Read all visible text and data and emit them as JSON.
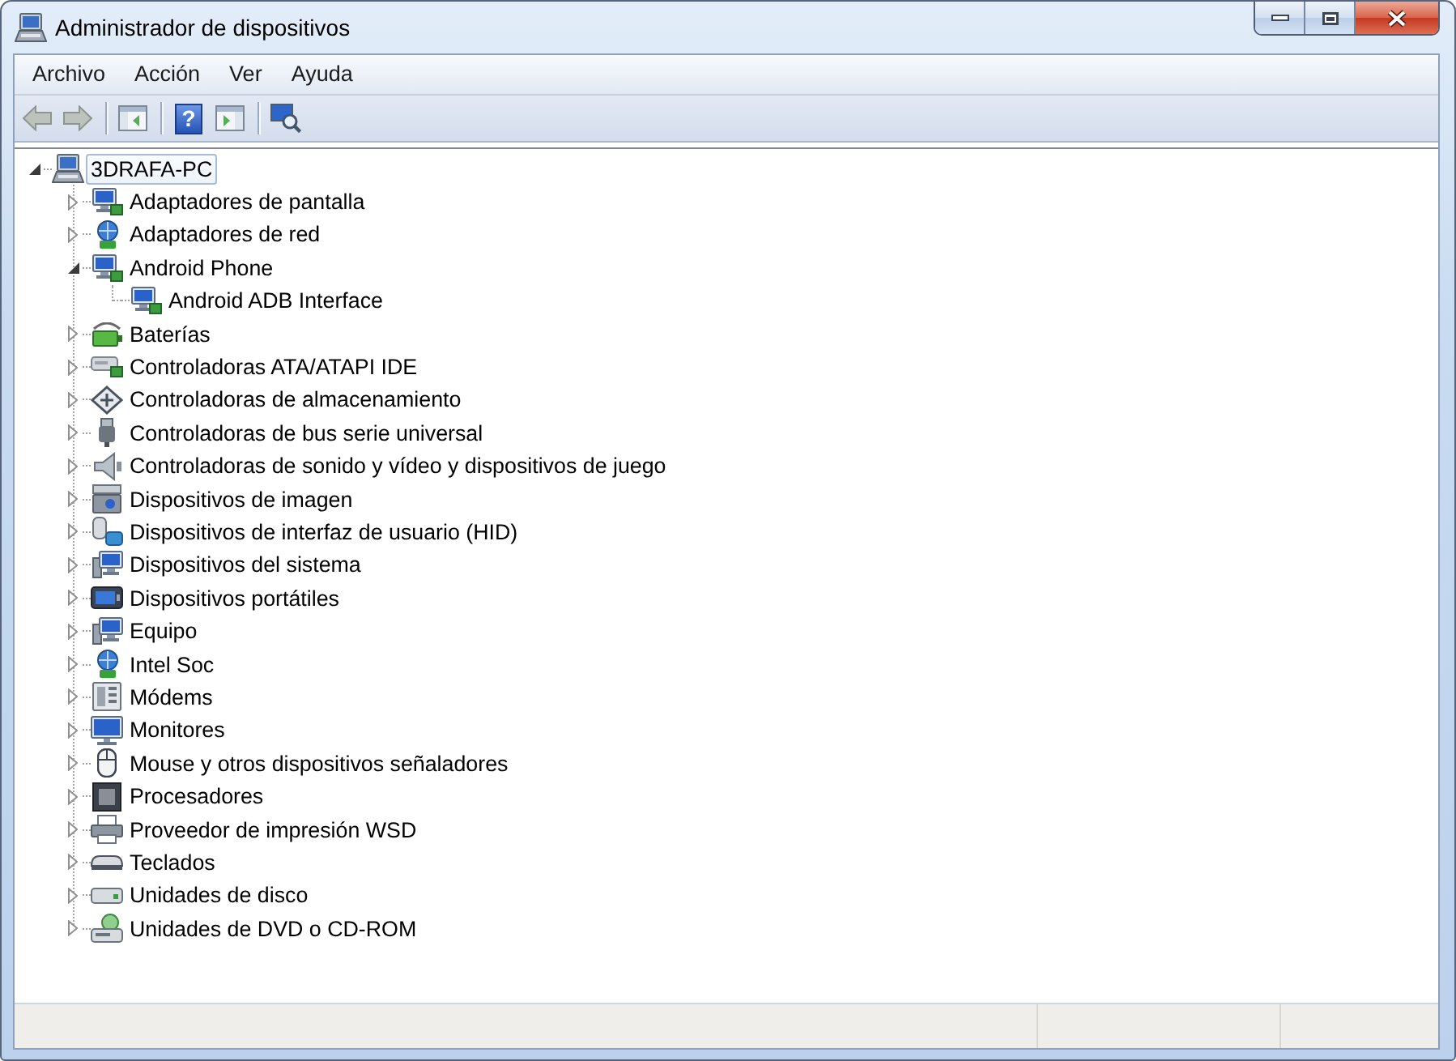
{
  "window": {
    "title": "Administrador de dispositivos"
  },
  "menu": [
    {
      "label": "Archivo"
    },
    {
      "label": "Acción"
    },
    {
      "label": "Ver"
    },
    {
      "label": "Ayuda"
    }
  ],
  "toolbar": [
    {
      "kind": "back",
      "disabled": true
    },
    {
      "kind": "forward",
      "disabled": true
    },
    {
      "kind": "separator"
    },
    {
      "kind": "tree",
      "disabled": false
    },
    {
      "kind": "separator"
    },
    {
      "kind": "help",
      "text": "?",
      "disabled": false
    },
    {
      "kind": "actions",
      "disabled": false
    },
    {
      "kind": "separator"
    },
    {
      "kind": "scan",
      "disabled": false
    }
  ],
  "tree": [
    {
      "label": "3DRAFA-PC",
      "kind": "pc",
      "expanded": true,
      "selected": true,
      "children": [
        {
          "label": "Adaptadores de pantalla",
          "kind": "display",
          "expanded": false,
          "selected": false
        },
        {
          "label": "Adaptadores de red",
          "kind": "network",
          "expanded": false,
          "selected": false
        },
        {
          "label": "Android Phone",
          "kind": "device",
          "expanded": true,
          "selected": false,
          "children": [
            {
              "label": "Android ADB Interface",
              "kind": "device",
              "selected": false
            }
          ]
        },
        {
          "label": "Baterías",
          "kind": "battery",
          "expanded": false,
          "selected": false
        },
        {
          "label": "Controladoras ATA/ATAPI IDE",
          "kind": "ide",
          "expanded": false,
          "selected": false
        },
        {
          "label": "Controladoras de almacenamiento",
          "kind": "storage",
          "expanded": false,
          "selected": false
        },
        {
          "label": "Controladoras de bus serie universal",
          "kind": "usb",
          "expanded": false,
          "selected": false
        },
        {
          "label": "Controladoras de sonido y vídeo y dispositivos de juego",
          "kind": "sound",
          "expanded": false,
          "selected": false
        },
        {
          "label": "Dispositivos de imagen",
          "kind": "imaging",
          "expanded": false,
          "selected": false
        },
        {
          "label": "Dispositivos de interfaz de usuario (HID)",
          "kind": "hid",
          "expanded": false,
          "selected": false
        },
        {
          "label": "Dispositivos del sistema",
          "kind": "system",
          "expanded": false,
          "selected": false
        },
        {
          "label": "Dispositivos portátiles",
          "kind": "portable",
          "expanded": false,
          "selected": false
        },
        {
          "label": "Equipo",
          "kind": "system",
          "expanded": false,
          "selected": false
        },
        {
          "label": "Intel Soc",
          "kind": "network",
          "expanded": false,
          "selected": false
        },
        {
          "label": "Módems",
          "kind": "modem",
          "expanded": false,
          "selected": false
        },
        {
          "label": "Monitores",
          "kind": "monitor",
          "expanded": false,
          "selected": false
        },
        {
          "label": "Mouse y otros dispositivos señaladores",
          "kind": "mouse",
          "expanded": false,
          "selected": false
        },
        {
          "label": "Procesadores",
          "kind": "cpu",
          "expanded": false,
          "selected": false
        },
        {
          "label": "Proveedor de impresión WSD",
          "kind": "printer",
          "expanded": false,
          "selected": false
        },
        {
          "label": "Teclados",
          "kind": "keyboard",
          "expanded": false,
          "selected": false
        },
        {
          "label": "Unidades de disco",
          "kind": "disk",
          "expanded": false,
          "selected": false
        },
        {
          "label": "Unidades de DVD o CD-ROM",
          "kind": "optical",
          "expanded": false,
          "selected": false
        }
      ]
    }
  ]
}
